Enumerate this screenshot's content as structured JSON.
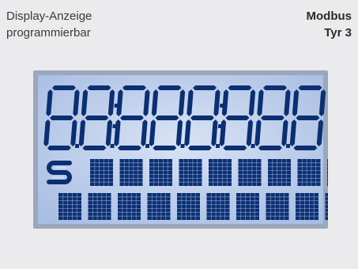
{
  "description": {
    "line1": "Display-Anzeige",
    "line2": "programmierbar"
  },
  "model": {
    "line1": "Modbus",
    "line2": "Tyr 3"
  },
  "display": {
    "digit_count": 8,
    "matrix_row1_cells": 9,
    "matrix_row2_cells": 10,
    "colors": {
      "segment": "#0b2f72",
      "bezel": "#9aa7bd",
      "screen_light": "#d9e3f5",
      "screen_dark": "#a8bde2"
    },
    "icon": "s-logo-icon"
  }
}
